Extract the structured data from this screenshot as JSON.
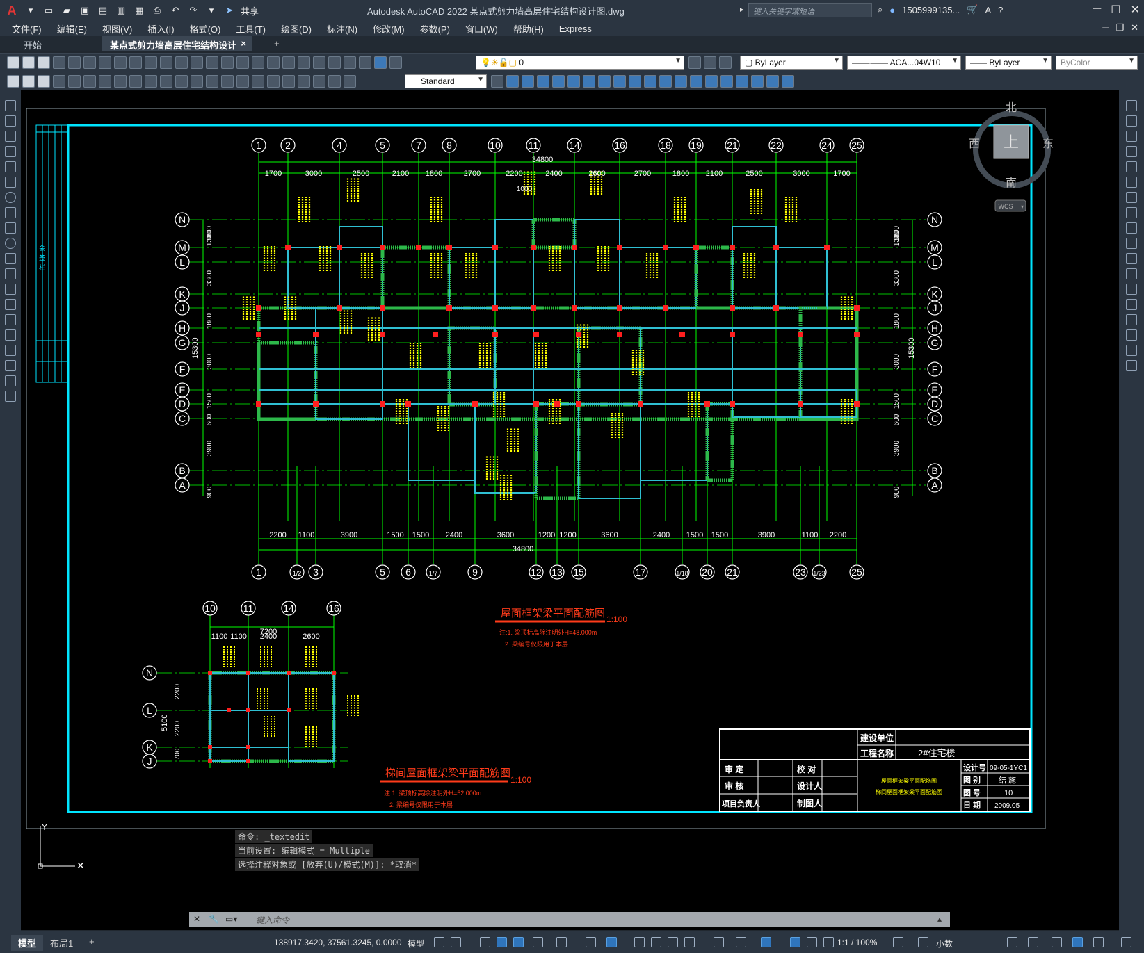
{
  "titlebar": {
    "app_title": "Autodesk AutoCAD 2022    某点式剪力墙高层住宅结构设计图.dwg",
    "share_label": "共享",
    "search_placeholder": "键入关键字或短语",
    "user": "1505999135...",
    "logo": "A"
  },
  "menu": {
    "items": [
      "文件(F)",
      "编辑(E)",
      "视图(V)",
      "插入(I)",
      "格式(O)",
      "工具(T)",
      "绘图(D)",
      "标注(N)",
      "修改(M)",
      "参数(P)",
      "窗口(W)",
      "帮助(H)",
      "Express"
    ]
  },
  "tabs": {
    "start": "开始",
    "file": "某点式剪力墙高层住宅结构设计图*",
    "close": "×",
    "add": "+"
  },
  "toolbar": {
    "layer": "0",
    "color": "ByLayer",
    "linetype": "ACA...04W10",
    "lineweight": "ByLayer",
    "plotstyle": "ByColor",
    "textstyle": "Standard"
  },
  "viewcube": {
    "north": "北",
    "south": "南",
    "east": "东",
    "west": "西",
    "top": "上",
    "wcs": "WCS"
  },
  "drawing": {
    "top_axes": [
      "1",
      "2",
      "4",
      "5",
      "7",
      "8",
      "10",
      "11",
      "14",
      "16",
      "18",
      "19",
      "21",
      "22",
      "24",
      "25"
    ],
    "top_dims": [
      "1700",
      "3000",
      "2500",
      "2100",
      "1800",
      "2700",
      "2200",
      "2400",
      "2600",
      "2700",
      "1800",
      "2100",
      "2500",
      "3000",
      "1700"
    ],
    "top_total": "34800",
    "bottom_axes": [
      "1",
      "1/2",
      "3",
      "5",
      "6",
      "1/7",
      "9",
      "12",
      "13",
      "15",
      "17",
      "1/18",
      "20",
      "21",
      "23",
      "1/23",
      "25"
    ],
    "bottom_dims": [
      "2200",
      "1100",
      "3900",
      "1500",
      "1500",
      "2400",
      "3600",
      "1200",
      "1200",
      "3600",
      "2400",
      "1500",
      "1500",
      "3900",
      "1100",
      "2200"
    ],
    "bottom_total": "34800",
    "rows": [
      "N",
      "M",
      "L",
      "K",
      "J",
      "H",
      "G",
      "F",
      "E",
      "D",
      "C",
      "B",
      "A"
    ],
    "left_dims": [
      "1800",
      "1300",
      "3300",
      "1800",
      "3000",
      "1500",
      "600",
      "3900",
      "900"
    ],
    "total_height": "15300",
    "dim_1000": "1000",
    "title1": "屋面框架梁平面配筋图",
    "scale1": "1:100",
    "note1a": "注:1. 梁顶标高除注明外H=48.000m",
    "note1b": "2. 梁编号仅限用于本层",
    "inset_axes": [
      "10",
      "11",
      "14",
      "16"
    ],
    "inset_total": "7200",
    "inset_dims": [
      "1100",
      "1100",
      "2400",
      "2600"
    ],
    "inset_rows": [
      "N",
      "L",
      "K",
      "J"
    ],
    "inset_left_dims": [
      "2200",
      "2200",
      "700"
    ],
    "inset_total_height": "5100",
    "title2": "梯间屋面框架梁平面配筋图",
    "scale2": "1:100",
    "note2a": "注:1. 梁顶标高除注明外H=52.000m",
    "note2b": "2. 梁编号仅限用于本层"
  },
  "titleblock": {
    "build_unit_label": "建设单位",
    "project_label": "工程名称",
    "project_value": "2#住宅楼",
    "check1": "审  定",
    "check2": "审  核",
    "check3": "项目负责人",
    "proof": "校  对",
    "designer": "设计人",
    "drafter": "制图人",
    "drawing_name1": "屋面框架梁平面配筋图",
    "drawing_name2": "梯间屋面框架梁平面配筋图",
    "design_no_label": "设计号",
    "design_no": "09-05-1YC1",
    "category_label": "图  别",
    "category": "结 施",
    "number_label": "图  号",
    "number": "10",
    "date_label": "日  期",
    "date": "2009.05"
  },
  "border_text": {
    "v1": "会",
    "v2": "签",
    "v3": "栏"
  },
  "command": {
    "line1": "命令: _textedit",
    "line2": "当前设置: 编辑模式 = Multiple",
    "line3": "选择注释对象或 [放弃(U)/模式(M)]: *取消*",
    "placeholder": "键入命令"
  },
  "statusbar": {
    "model_tab": "模型",
    "layout_tab": "布局1",
    "add": "+",
    "coords": "138917.3420, 37561.3245, 0.0000",
    "space": "模型",
    "scale": "1:1 / 100%",
    "units": "小数"
  },
  "colors": {
    "frame": "#00e5ff",
    "axis": "#00ff00",
    "beam": "#2fbfd2",
    "wall_hatch": "#2db84a",
    "label": "#ffff00",
    "title_red": "#ff3b1a",
    "column_red": "#ff1f1f"
  }
}
